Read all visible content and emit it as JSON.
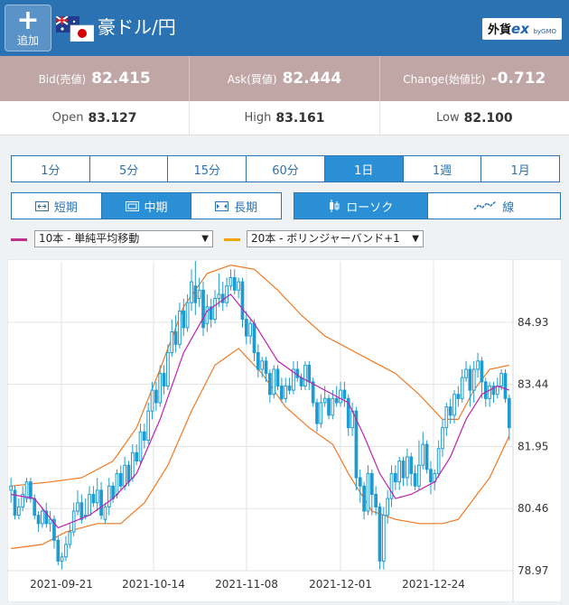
{
  "header": {
    "add_label": "追加",
    "pair_title": "豪ドル/円",
    "brand_text": "外貨",
    "brand_ex": "ex",
    "brand_gmo": "byGMO"
  },
  "quotes": {
    "bid_label": "Bid(売値)",
    "bid_value": "82.415",
    "ask_label": "Ask(買値)",
    "ask_value": "82.444",
    "change_label": "Change(始値比)",
    "change_value": "-0.712"
  },
  "ohl": {
    "open_label": "Open",
    "open_value": "83.127",
    "high_label": "High",
    "high_value": "83.161",
    "low_label": "Low",
    "low_value": "82.100"
  },
  "timeframes": [
    "1分",
    "5分",
    "15分",
    "60分",
    "1日",
    "1週",
    "1月"
  ],
  "active_timeframe": "1日",
  "terms": [
    "短期",
    "中期",
    "長期"
  ],
  "active_term": "中期",
  "chart_types": [
    "ローソク",
    "線"
  ],
  "active_chart_type": "ローソク",
  "indicators": [
    {
      "label": "10本 - 単純平均移動",
      "color": "#c0308f"
    },
    {
      "label": "20本 - ボリンジャーバンド+1",
      "color": "#f5a300"
    }
  ],
  "colors": {
    "header": "#2b72b3",
    "candle": "#1e9bd1",
    "ma": "#c020b0",
    "band": "#f07820"
  },
  "chart_data": {
    "type": "candlestick",
    "ylim": [
      78.97,
      86.4
    ],
    "y_ticks": [
      "84.93",
      "83.44",
      "81.95",
      "80.46",
      "78.97"
    ],
    "x_ticks": [
      "2021-09-21",
      "2021-10-14",
      "2021-11-08",
      "2021-12-01",
      "2021-12-24"
    ],
    "candles": [
      [
        80.9,
        81.0,
        81.2,
        80.6
      ],
      [
        80.9,
        80.3,
        81.0,
        80.2
      ],
      [
        80.3,
        80.5,
        80.7,
        80.2
      ],
      [
        80.5,
        80.8,
        81.0,
        80.4
      ],
      [
        80.7,
        81.1,
        81.2,
        80.6
      ],
      [
        81.1,
        80.7,
        81.2,
        80.6
      ],
      [
        80.7,
        80.3,
        80.8,
        80.2
      ],
      [
        80.3,
        80.1,
        80.4,
        79.9
      ],
      [
        80.1,
        80.4,
        80.5,
        80.0
      ],
      [
        80.4,
        80.1,
        80.6,
        80.0
      ],
      [
        80.1,
        80.2,
        80.4,
        79.9
      ],
      [
        80.2,
        79.7,
        80.3,
        79.5
      ],
      [
        79.7,
        79.2,
        79.8,
        79.1
      ],
      [
        79.2,
        79.3,
        79.4,
        79.0
      ],
      [
        79.3,
        79.6,
        79.8,
        79.2
      ],
      [
        79.6,
        79.9,
        80.1,
        79.5
      ],
      [
        79.9,
        80.4,
        80.6,
        79.8
      ],
      [
        80.4,
        80.6,
        80.9,
        80.3
      ],
      [
        80.6,
        80.2,
        80.8,
        80.1
      ],
      [
        80.3,
        80.3,
        80.7,
        80.2
      ],
      [
        80.3,
        80.8,
        81.0,
        80.3
      ],
      [
        80.8,
        80.6,
        81.0,
        80.5
      ],
      [
        80.6,
        80.9,
        81.2,
        80.4
      ],
      [
        80.9,
        80.3,
        81.1,
        80.2
      ],
      [
        80.2,
        80.5,
        80.6,
        80.1
      ],
      [
        80.5,
        81.0,
        81.2,
        80.3
      ],
      [
        81.0,
        80.7,
        81.1,
        80.6
      ],
      [
        80.8,
        81.3,
        81.4,
        80.7
      ],
      [
        81.3,
        81.0,
        81.5,
        80.9
      ],
      [
        81.0,
        81.5,
        81.7,
        80.9
      ],
      [
        81.5,
        81.1,
        81.6,
        81.0
      ],
      [
        81.2,
        81.8,
        82.0,
        81.1
      ],
      [
        81.8,
        81.6,
        82.0,
        81.5
      ],
      [
        81.6,
        82.3,
        82.5,
        81.5
      ],
      [
        82.3,
        82.1,
        82.5,
        81.9
      ],
      [
        82.1,
        82.8,
        83.0,
        82.0
      ],
      [
        82.8,
        83.3,
        83.5,
        82.6
      ],
      [
        83.3,
        83.0,
        83.5,
        82.8
      ],
      [
        83.0,
        83.7,
        83.9,
        82.9
      ],
      [
        83.7,
        83.4,
        83.9,
        83.2
      ],
      [
        83.4,
        84.2,
        84.4,
        83.3
      ],
      [
        84.2,
        84.7,
        85.0,
        84.1
      ],
      [
        84.7,
        84.4,
        85.1,
        84.2
      ],
      [
        84.4,
        85.2,
        85.4,
        84.3
      ],
      [
        85.2,
        84.8,
        85.5,
        84.6
      ],
      [
        84.8,
        85.4,
        85.6,
        84.7
      ],
      [
        85.4,
        85.9,
        86.2,
        85.2
      ],
      [
        85.8,
        85.4,
        86.4,
        85.1
      ],
      [
        85.5,
        85.7,
        86.0,
        85.3
      ],
      [
        85.7,
        84.8,
        85.9,
        84.6
      ],
      [
        84.9,
        85.3,
        85.6,
        84.7
      ],
      [
        85.3,
        85.0,
        85.5,
        84.8
      ],
      [
        85.0,
        85.5,
        85.7,
        84.9
      ],
      [
        85.5,
        85.6,
        86.1,
        85.3
      ],
      [
        85.6,
        85.4,
        85.9,
        85.2
      ],
      [
        85.4,
        85.8,
        86.0,
        85.3
      ],
      [
        85.8,
        86.0,
        86.2,
        85.7
      ],
      [
        86.0,
        85.7,
        86.2,
        85.6
      ],
      [
        85.7,
        85.9,
        86.0,
        85.5
      ],
      [
        85.9,
        85.0,
        86.0,
        84.8
      ],
      [
        85.0,
        84.6,
        85.2,
        84.4
      ],
      [
        84.6,
        84.9,
        85.0,
        84.4
      ],
      [
        84.9,
        84.2,
        85.0,
        84.0
      ],
      [
        84.2,
        83.8,
        84.4,
        83.6
      ],
      [
        83.8,
        84.0,
        84.1,
        83.6
      ],
      [
        84.0,
        83.7,
        84.1,
        83.5
      ],
      [
        83.7,
        83.2,
        83.8,
        83.0
      ],
      [
        83.2,
        83.8,
        83.9,
        83.1
      ],
      [
        83.8,
        83.4,
        83.9,
        83.3
      ],
      [
        83.4,
        83.1,
        83.6,
        83.0
      ],
      [
        83.1,
        83.4,
        83.6,
        83.0
      ],
      [
        83.4,
        83.3,
        83.6,
        83.2
      ],
      [
        83.3,
        83.8,
        84.0,
        83.2
      ],
      [
        83.8,
        83.6,
        84.0,
        83.5
      ],
      [
        83.6,
        83.4,
        83.7,
        83.3
      ],
      [
        83.4,
        83.9,
        84.0,
        83.3
      ],
      [
        83.9,
        83.5,
        84.0,
        83.3
      ],
      [
        83.5,
        83.0,
        83.6,
        82.9
      ],
      [
        83.0,
        82.5,
        83.1,
        82.3
      ],
      [
        82.5,
        83.0,
        83.2,
        82.4
      ],
      [
        83.0,
        83.1,
        83.4,
        82.9
      ],
      [
        83.1,
        82.7,
        83.2,
        82.6
      ],
      [
        82.7,
        83.1,
        83.3,
        82.6
      ],
      [
        83.1,
        83.0,
        83.4,
        82.9
      ],
      [
        83.0,
        83.3,
        83.5,
        82.9
      ],
      [
        83.3,
        83.1,
        83.5,
        82.9
      ],
      [
        83.1,
        82.4,
        83.2,
        82.2
      ],
      [
        82.4,
        82.8,
        83.0,
        82.2
      ],
      [
        82.8,
        81.2,
        82.9,
        80.9
      ],
      [
        81.2,
        81.0,
        81.4,
        80.6
      ],
      [
        81.0,
        80.4,
        81.1,
        80.2
      ],
      [
        80.4,
        81.3,
        81.5,
        80.3
      ],
      [
        81.3,
        80.8,
        81.4,
        80.3
      ],
      [
        80.8,
        80.5,
        81.0,
        80.3
      ],
      [
        80.5,
        79.2,
        80.6,
        79.0
      ],
      [
        79.2,
        80.3,
        80.5,
        79.0
      ],
      [
        80.3,
        80.7,
        80.9,
        80.1
      ],
      [
        80.7,
        81.3,
        81.5,
        80.5
      ],
      [
        81.3,
        81.1,
        81.5,
        80.9
      ],
      [
        81.1,
        81.6,
        81.7,
        80.9
      ],
      [
        81.6,
        81.2,
        81.7,
        81.0
      ],
      [
        81.2,
        81.7,
        81.9,
        81.0
      ],
      [
        81.7,
        81.3,
        81.8,
        81.0
      ],
      [
        81.3,
        81.0,
        81.5,
        80.9
      ],
      [
        81.0,
        81.5,
        82.1,
        80.9
      ],
      [
        81.5,
        82.0,
        82.3,
        81.4
      ],
      [
        82.0,
        81.4,
        82.1,
        81.3
      ],
      [
        81.4,
        81.1,
        81.6,
        80.8
      ],
      [
        81.1,
        81.3,
        81.4,
        80.9
      ],
      [
        81.3,
        81.9,
        82.1,
        81.2
      ],
      [
        81.9,
        82.4,
        82.6,
        81.7
      ],
      [
        82.4,
        82.9,
        83.0,
        82.2
      ],
      [
        82.9,
        82.7,
        83.1,
        82.5
      ],
      [
        82.7,
        83.2,
        83.3,
        82.5
      ],
      [
        83.2,
        83.1,
        83.4,
        82.9
      ],
      [
        83.1,
        83.6,
        83.8,
        83.0
      ],
      [
        83.6,
        83.8,
        84.0,
        83.5
      ],
      [
        83.8,
        83.3,
        83.9,
        82.9
      ],
      [
        83.3,
        83.8,
        84.0,
        83.0
      ],
      [
        83.8,
        84.0,
        84.2,
        83.6
      ],
      [
        84.0,
        83.5,
        84.1,
        83.1
      ],
      [
        83.5,
        83.1,
        83.6,
        82.9
      ],
      [
        83.1,
        83.4,
        83.5,
        82.9
      ],
      [
        83.4,
        83.2,
        83.5,
        83.0
      ],
      [
        83.2,
        83.4,
        83.6,
        83.1
      ],
      [
        83.4,
        83.7,
        83.8,
        83.3
      ],
      [
        83.7,
        83.1,
        83.8,
        83.0
      ],
      [
        83.1,
        82.4,
        83.2,
        82.1
      ]
    ],
    "ma": [
      [
        0,
        80.8
      ],
      [
        6,
        80.7
      ],
      [
        12,
        80.0
      ],
      [
        20,
        80.3
      ],
      [
        26,
        80.7
      ],
      [
        32,
        81.3
      ],
      [
        38,
        82.6
      ],
      [
        44,
        84.2
      ],
      [
        50,
        85.2
      ],
      [
        56,
        85.6
      ],
      [
        62,
        84.9
      ],
      [
        68,
        84.0
      ],
      [
        74,
        83.6
      ],
      [
        80,
        83.3
      ],
      [
        86,
        83.0
      ],
      [
        90,
        82.2
      ],
      [
        94,
        81.3
      ],
      [
        98,
        80.7
      ],
      [
        102,
        80.8
      ],
      [
        108,
        81.1
      ],
      [
        112,
        81.7
      ],
      [
        116,
        82.6
      ],
      [
        120,
        83.2
      ],
      [
        124,
        83.4
      ],
      [
        127,
        83.3
      ]
    ],
    "upper_band": [
      [
        0,
        81.0
      ],
      [
        10,
        81.1
      ],
      [
        18,
        81.2
      ],
      [
        26,
        81.6
      ],
      [
        32,
        82.4
      ],
      [
        38,
        83.8
      ],
      [
        44,
        85.3
      ],
      [
        50,
        86.1
      ],
      [
        56,
        86.3
      ],
      [
        62,
        86.2
      ],
      [
        68,
        85.7
      ],
      [
        74,
        85.1
      ],
      [
        80,
        84.6
      ],
      [
        86,
        84.3
      ],
      [
        92,
        84.0
      ],
      [
        98,
        83.7
      ],
      [
        104,
        83.2
      ],
      [
        110,
        82.6
      ],
      [
        114,
        82.6
      ],
      [
        118,
        83.3
      ],
      [
        122,
        83.8
      ],
      [
        127,
        83.9
      ]
    ],
    "lower_band": [
      [
        0,
        79.5
      ],
      [
        8,
        79.6
      ],
      [
        14,
        79.9
      ],
      [
        22,
        80.1
      ],
      [
        28,
        80.1
      ],
      [
        34,
        80.6
      ],
      [
        40,
        81.5
      ],
      [
        46,
        82.8
      ],
      [
        52,
        83.9
      ],
      [
        58,
        84.3
      ],
      [
        64,
        83.7
      ],
      [
        70,
        82.9
      ],
      [
        76,
        82.4
      ],
      [
        82,
        82.0
      ],
      [
        86,
        81.3
      ],
      [
        92,
        80.4
      ],
      [
        98,
        80.2
      ],
      [
        104,
        80.1
      ],
      [
        110,
        80.1
      ],
      [
        114,
        80.2
      ],
      [
        118,
        80.7
      ],
      [
        122,
        81.2
      ],
      [
        127,
        82.2
      ]
    ]
  }
}
